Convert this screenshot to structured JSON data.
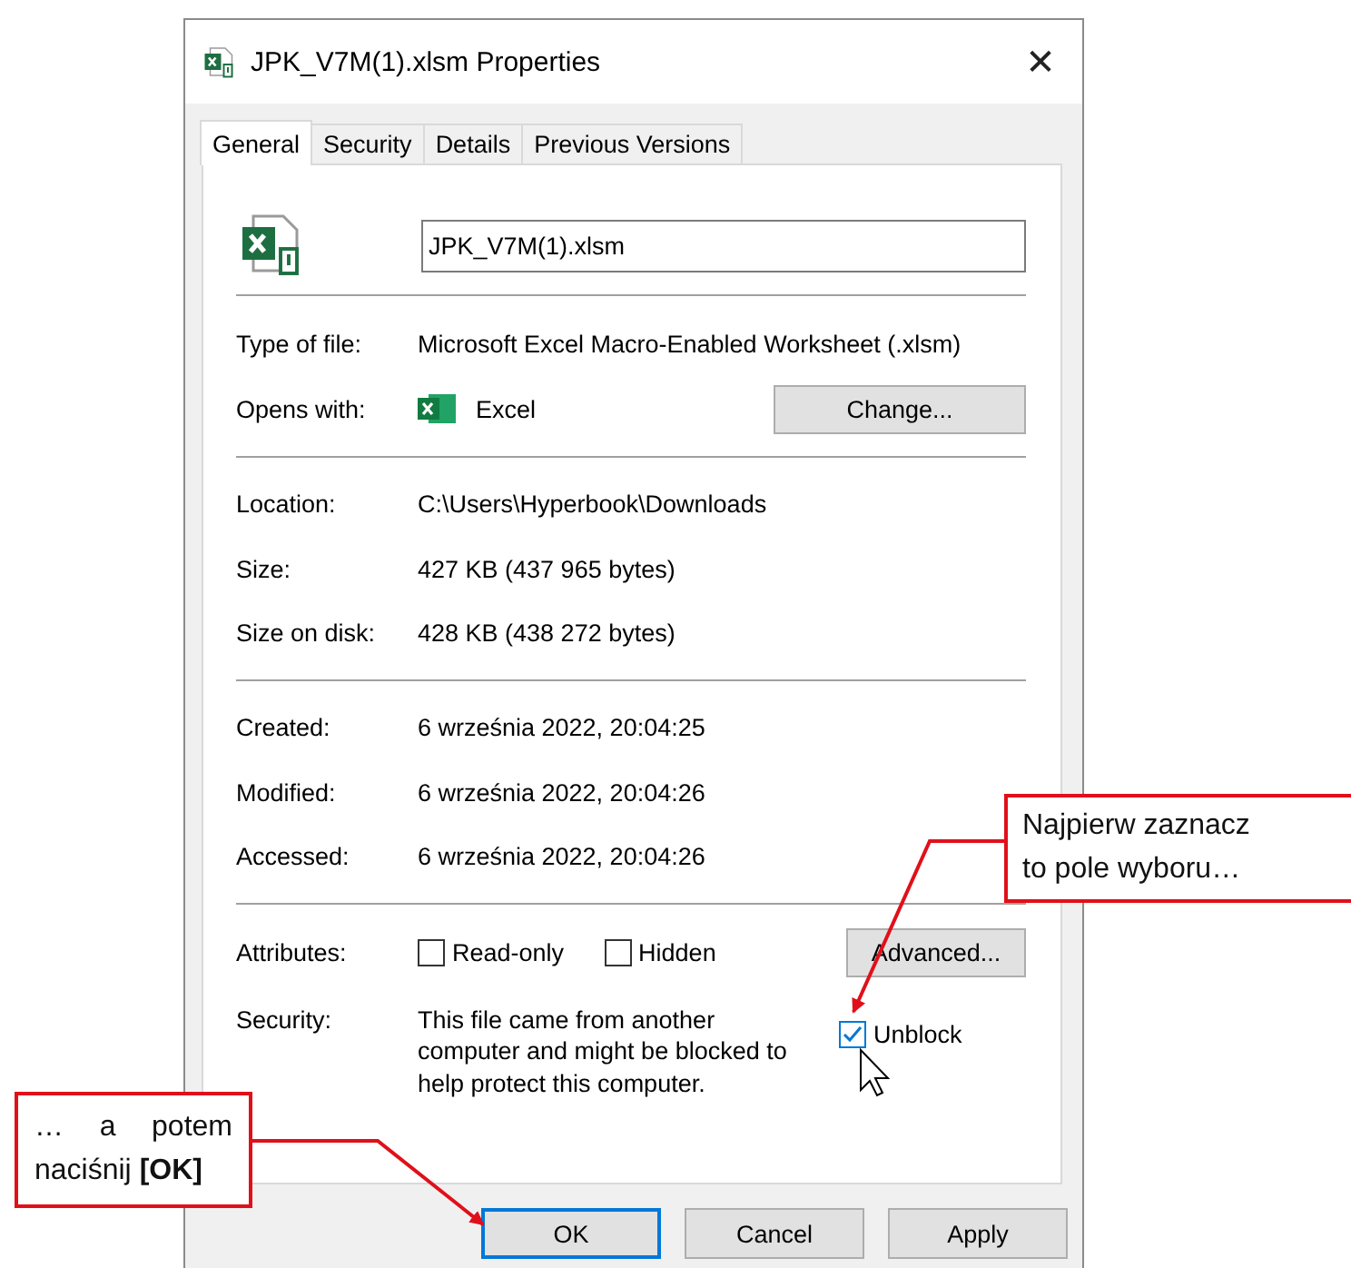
{
  "window": {
    "title": "JPK_V7M(1).xlsm Properties",
    "close": "✕"
  },
  "tabs": [
    {
      "label": "General",
      "selected": true
    },
    {
      "label": "Security",
      "selected": false
    },
    {
      "label": "Details",
      "selected": false
    },
    {
      "label": "Previous Versions",
      "selected": false
    }
  ],
  "file_name": "JPK_V7M(1).xlsm",
  "type_section": [
    {
      "label": "Type of file:",
      "value": "Microsoft Excel Macro-Enabled Worksheet (.xlsm)"
    },
    {
      "label": "Opens with:",
      "value": "Excel",
      "button": "Change..."
    }
  ],
  "location_section": [
    {
      "label": "Location:",
      "value": "C:\\Users\\Hyperbook\\Downloads"
    },
    {
      "label": "Size:",
      "value": "427 KB (437 965 bytes)"
    },
    {
      "label": "Size on disk:",
      "value": "428 KB (438 272 bytes)"
    }
  ],
  "dates_section": [
    {
      "label": "Created:",
      "value": "6 września 2022, 20:04:25"
    },
    {
      "label": "Modified:",
      "value": "6 września 2022, 20:04:26"
    },
    {
      "label": "Accessed:",
      "value": "6 września 2022, 20:04:26"
    }
  ],
  "attributes": {
    "label": "Attributes:",
    "checkboxes": [
      {
        "label": "Read-only",
        "checked": false
      },
      {
        "label": "Hidden",
        "checked": false
      }
    ],
    "button": "Advanced..."
  },
  "security": {
    "label": "Security:",
    "text": "This file came from another computer and might be blocked to help protect this computer.",
    "checkbox": {
      "label": "Unblock",
      "checked": true
    }
  },
  "buttons": [
    {
      "label": "OK",
      "selected": true
    },
    {
      "label": "Cancel",
      "selected": false
    },
    {
      "label": "Apply",
      "selected": false
    }
  ],
  "callouts": [
    {
      "text": "Najpierw zaznacz to pole wyboru…"
    },
    {
      "text": "… a potem naciśnij **[OK]**"
    }
  ]
}
